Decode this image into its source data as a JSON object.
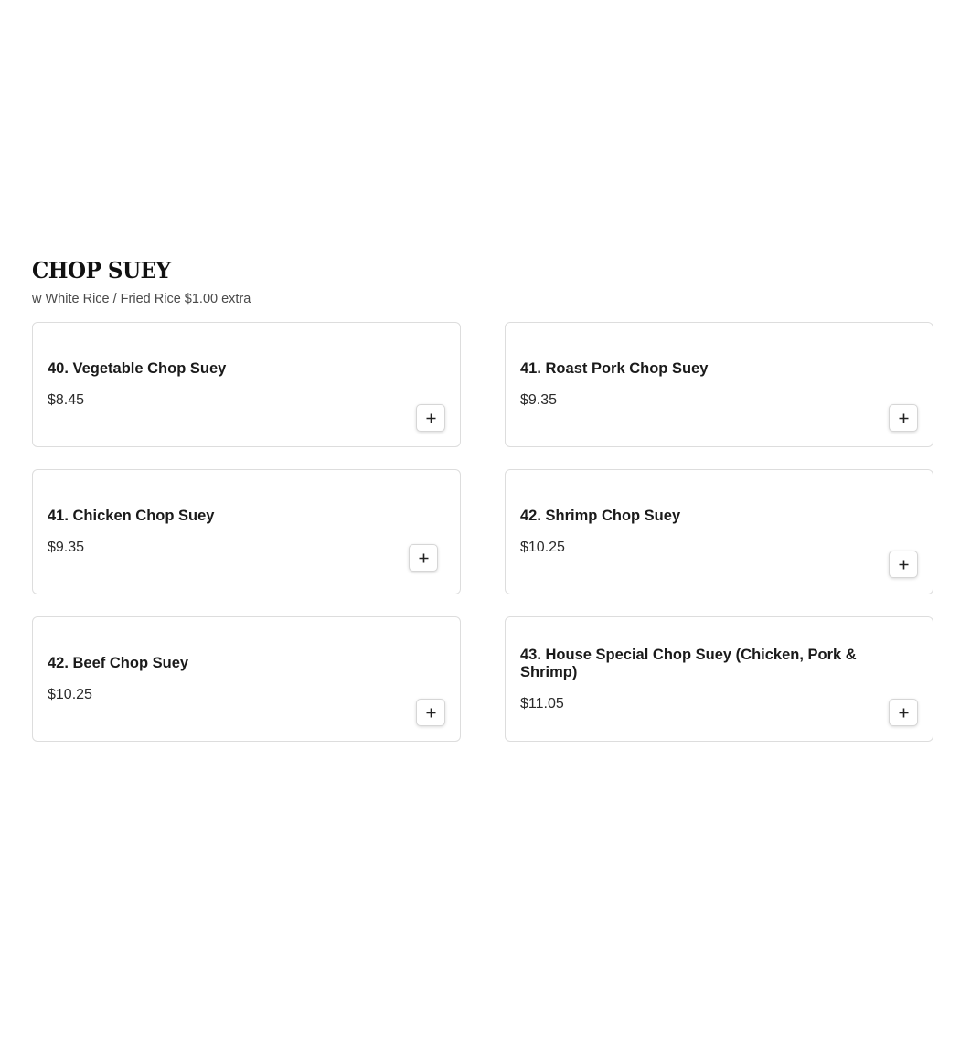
{
  "section": {
    "title": "CHOP SUEY",
    "subtitle": "w White Rice / Fried Rice $1.00 extra"
  },
  "items": [
    {
      "name": "40. Vegetable Chop Suey",
      "price": "$8.45",
      "icon": "plus-icon"
    },
    {
      "name": "41. Roast Pork Chop Suey",
      "price": "$9.35",
      "icon": "plus-icon"
    },
    {
      "name": "41. Chicken Chop Suey",
      "price": "$9.35",
      "icon": "plus-icon"
    },
    {
      "name": "42. Shrimp Chop Suey",
      "price": "$10.25",
      "icon": "plus-icon"
    },
    {
      "name": "42. Beef Chop Suey",
      "price": "$10.25",
      "icon": "plus-icon"
    },
    {
      "name": "43. House Special Chop Suey (Chicken, Pork & Shrimp)",
      "price": "$11.05",
      "icon": "plus-icon"
    }
  ]
}
